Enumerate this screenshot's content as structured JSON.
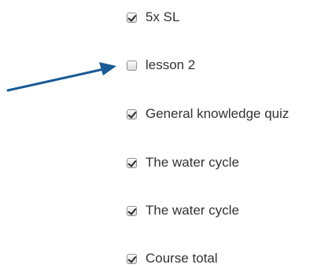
{
  "items": [
    {
      "label": "5x SL",
      "checked": true
    },
    {
      "label": "lesson 2",
      "checked": false
    },
    {
      "label": "General knowledge quiz",
      "checked": true
    },
    {
      "label": "The water cycle",
      "checked": true
    },
    {
      "label": "The water cycle",
      "checked": true
    },
    {
      "label": "Course total",
      "checked": true
    }
  ],
  "colors": {
    "arrow": "#1a5a96",
    "text": "#333333"
  },
  "icons": {
    "pointer": "arrow-icon",
    "checkbox": "checkbox-icon"
  }
}
